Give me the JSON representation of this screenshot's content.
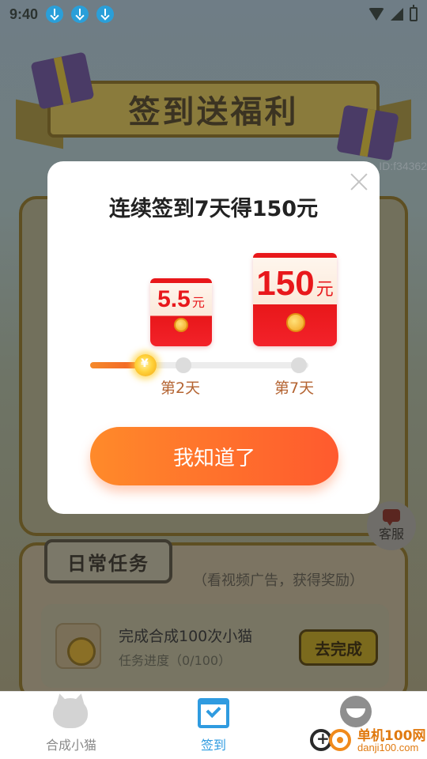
{
  "status_bar": {
    "time": "9:40"
  },
  "banner": {
    "title": "签到送福利"
  },
  "background": {
    "id_text": "ID:f34362"
  },
  "modal": {
    "title": "连续签到7天得150元",
    "rewards": [
      {
        "amount": "5.5",
        "unit": "元"
      },
      {
        "amount": "150",
        "unit": "元"
      }
    ],
    "progress": {
      "fraction": 0.26,
      "day_labels": [
        "第2天",
        "第7天"
      ]
    },
    "confirm_label": "我知道了"
  },
  "service": {
    "label": "客服"
  },
  "daily_tasks": {
    "header": "日常任务",
    "subtitle": "（看视频广告，获得奖励）",
    "items": [
      {
        "title": "完成合成100次小猫",
        "progress": "任务进度（0/100）",
        "button": "去完成"
      }
    ]
  },
  "bottom_nav": {
    "items": [
      {
        "label": "合成小猫",
        "icon": "cat-icon",
        "active": false
      },
      {
        "label": "签到",
        "icon": "calendar-check-icon",
        "active": true
      }
    ]
  },
  "watermark": {
    "name": "单机100网",
    "url": "danji100.com"
  },
  "colors": {
    "accent_orange": "#ff6a2c",
    "envelope_red": "#e8171a",
    "nav_active": "#2f9be0"
  }
}
